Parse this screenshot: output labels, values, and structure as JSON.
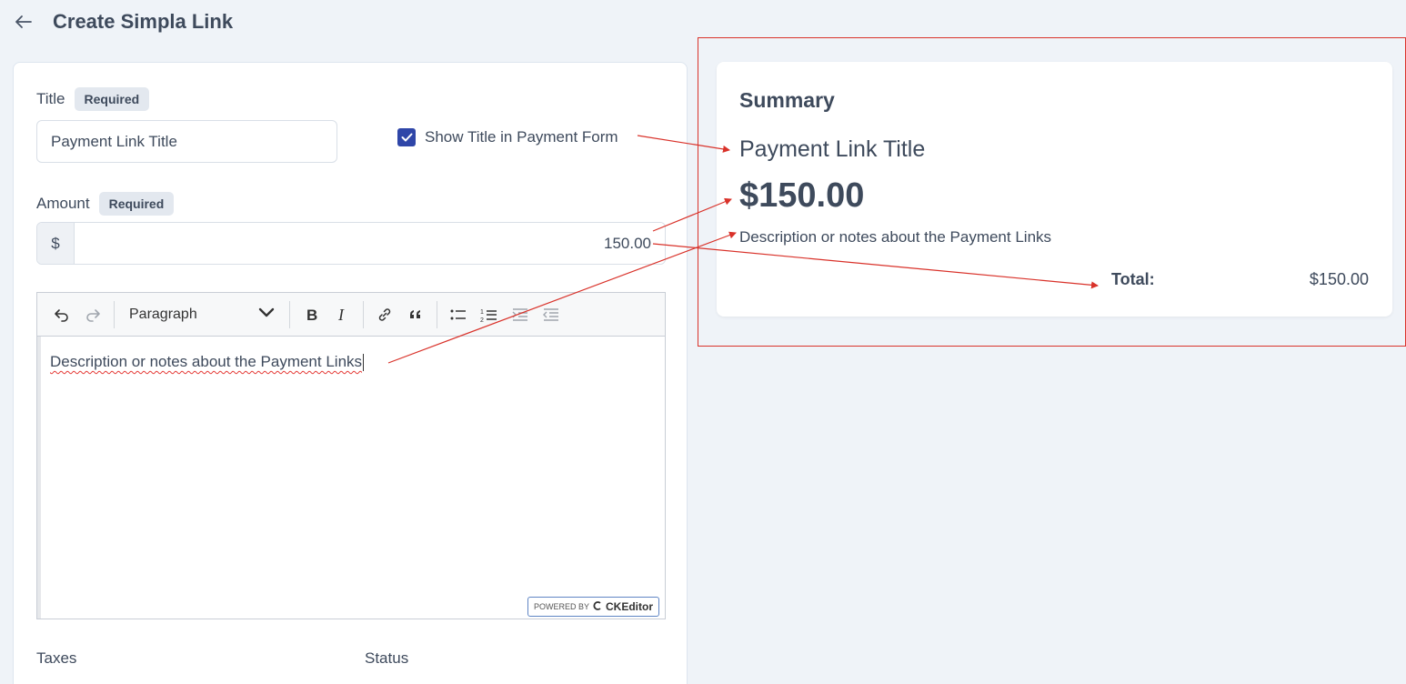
{
  "page": {
    "title": "Create Simpla Link"
  },
  "form": {
    "title_label": "Title",
    "required_badge": "Required",
    "title_value": "Payment Link Title",
    "show_title_label": "Show Title in Payment Form",
    "show_title_checked": true,
    "amount_label": "Amount",
    "currency_symbol": "$",
    "amount_value": "150.00",
    "editor": {
      "heading_select": "Paragraph",
      "content": "Description or notes about the Payment Links",
      "powered_prefix": "POWERED BY",
      "powered_brand": "CKEditor",
      "toolbar_icons": [
        "undo-icon",
        "redo-icon",
        "bold-icon",
        "italic-icon",
        "link-icon",
        "blockquote-icon",
        "bulleted-list-icon",
        "numbered-list-icon",
        "indent-icon",
        "outdent-icon"
      ]
    },
    "taxes_label": "Taxes",
    "status_label": "Status"
  },
  "summary": {
    "heading": "Summary",
    "title": "Payment Link Title",
    "amount": "$150.00",
    "description": "Description or notes about the Payment Links",
    "total_label": "Total:",
    "total_value": "$150.00"
  },
  "colors": {
    "annotation": "#d9322a",
    "checkbox": "#2f46a8",
    "background": "#eff3f8"
  }
}
